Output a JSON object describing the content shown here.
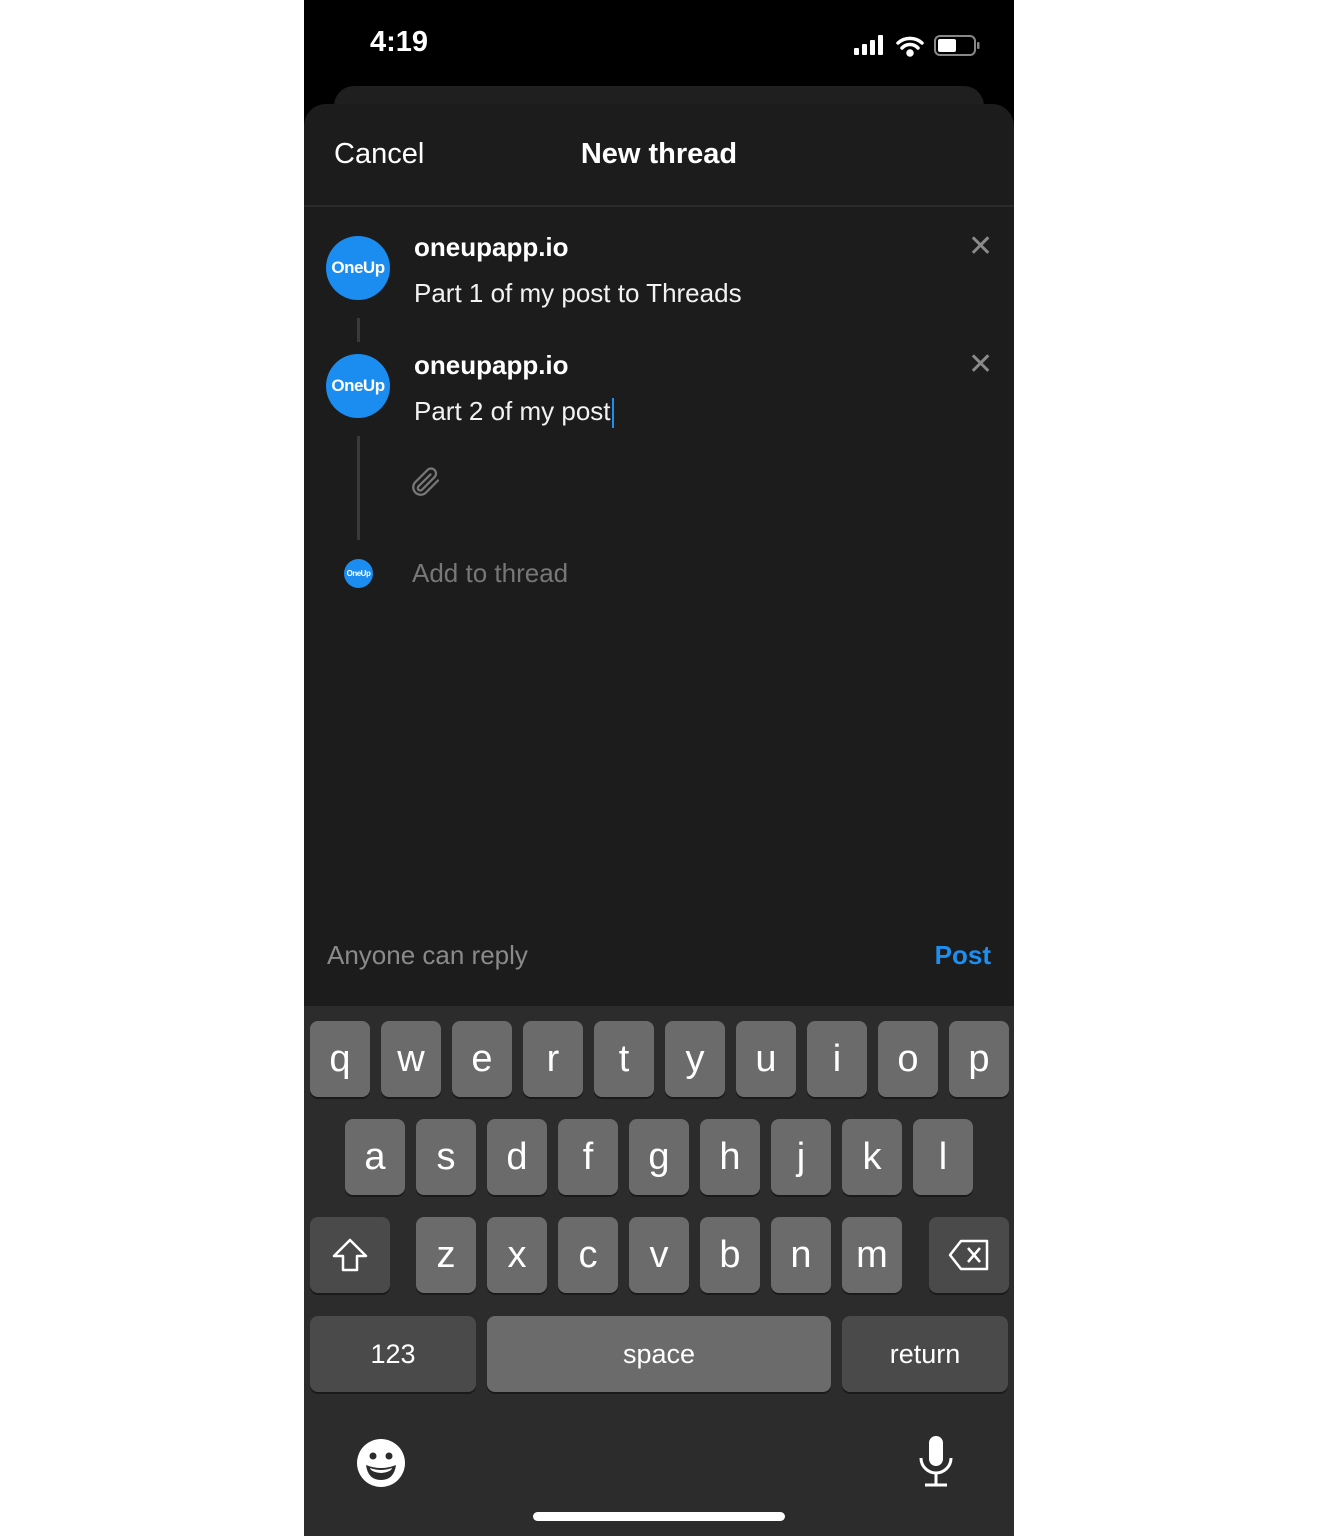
{
  "status_bar": {
    "time": "4:19",
    "icons": [
      "signal-icon",
      "wifi-icon",
      "battery-icon"
    ],
    "battery_level": 0.5
  },
  "header": {
    "cancel_label": "Cancel",
    "title": "New thread"
  },
  "posts": [
    {
      "avatar_text": "OneUp",
      "username": "oneupapp.io",
      "text": "Part 1 of my post to Threads"
    },
    {
      "avatar_text": "OneUp",
      "username": "oneupapp.io",
      "text": "Part 2 of my post"
    }
  ],
  "add_thread": {
    "avatar_text": "OneUp",
    "placeholder": "Add to thread"
  },
  "footer": {
    "reply_setting": "Anyone can reply",
    "post_label": "Post"
  },
  "colors": {
    "accent": "#1d8ff0",
    "avatar": "#1b8cf0",
    "sheet": "#1c1c1c",
    "keyboard": "#2c2c2c"
  },
  "keyboard": {
    "row1": [
      "q",
      "w",
      "e",
      "r",
      "t",
      "y",
      "u",
      "i",
      "o",
      "p"
    ],
    "row2": [
      "a",
      "s",
      "d",
      "f",
      "g",
      "h",
      "j",
      "k",
      "l"
    ],
    "row3": [
      "z",
      "x",
      "c",
      "v",
      "b",
      "n",
      "m"
    ],
    "numbers_label": "123",
    "space_label": "space",
    "return_label": "return"
  }
}
